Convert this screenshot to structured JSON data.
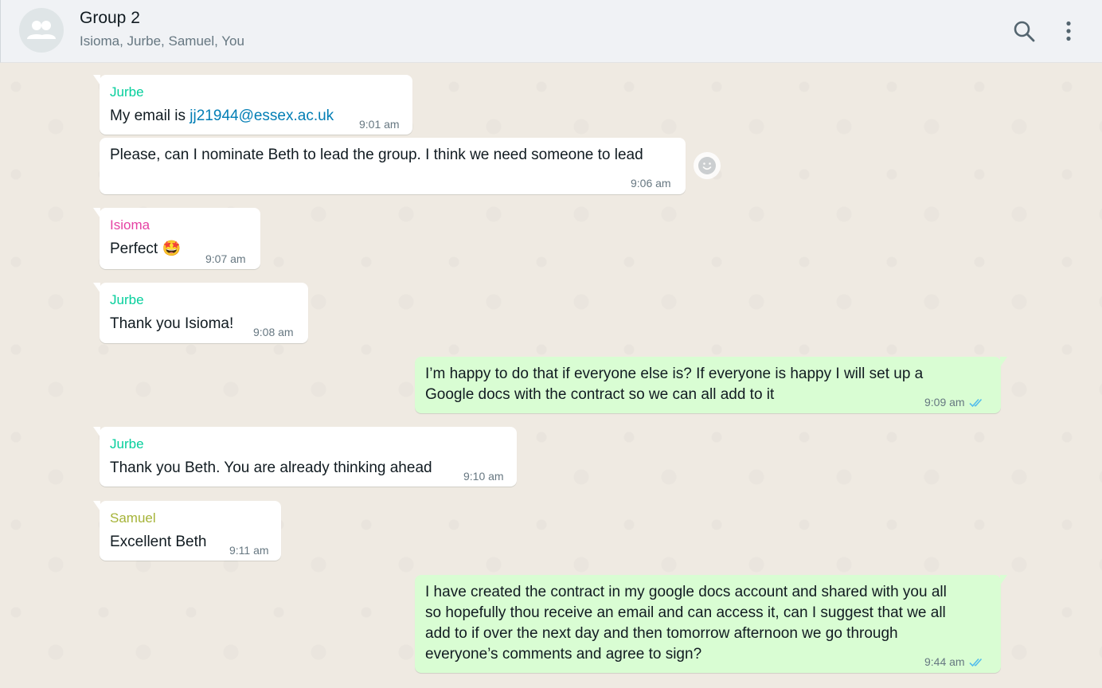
{
  "header": {
    "title": "Group 2",
    "members": "Isioma, Jurbe, Samuel, You",
    "avatar_icon": "group-icon",
    "search_icon": "search-icon",
    "menu_icon": "more-vert-icon"
  },
  "colors": {
    "jurbe": "#06cf9c",
    "isioma": "#e542a3",
    "samuel": "#a5b337",
    "outgoing_bubble": "#d9fdd3",
    "incoming_bubble": "#ffffff",
    "link": "#027eb5",
    "read_ticks": "#53bdeb"
  },
  "messages": [
    {
      "sender": "Jurbe",
      "text_prefix": "My email is ",
      "link": "jj21944@essex.ac.uk",
      "time": "9:01 am"
    },
    {
      "text": "Please, can I nominate Beth to lead the group. I think we need someone to lead",
      "time": "9:06 am"
    },
    {
      "sender": "Isioma",
      "text": "Perfect",
      "emoji": "🤩",
      "time": "9:07 am"
    },
    {
      "sender": "Jurbe",
      "text": "Thank you Isioma!",
      "time": "9:08 am"
    },
    {
      "lines": [
        "I’m happy to do that if everyone else is? If everyone is happy I will set up a",
        "Google docs with the contract so we can all add to it"
      ],
      "time": "9:09 am",
      "status": "read"
    },
    {
      "sender": "Jurbe",
      "text": "Thank you Beth. You are already thinking ahead",
      "time": "9:10 am"
    },
    {
      "sender": "Samuel",
      "text": "Excellent Beth",
      "time": "9:11 am"
    },
    {
      "lines": [
        "I have created the contract in my google docs account and shared with you all",
        "so hopefully thou receive an email and can access it, can I suggest that we all",
        "add to if over the next day and then tomorrow afternoon we go through",
        "everyone’s comments and agree to sign?"
      ],
      "time": "9:44 am",
      "status": "read"
    }
  ],
  "reaction_icon": "smiley-icon"
}
